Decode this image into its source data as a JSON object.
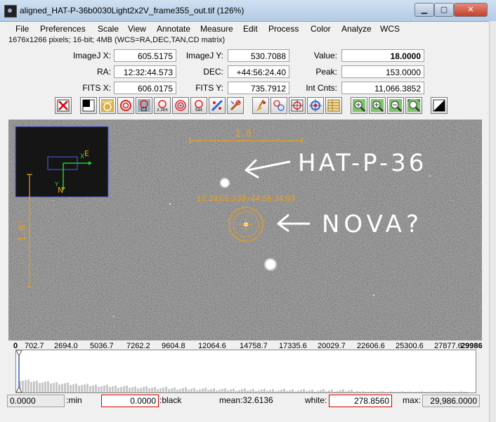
{
  "window": {
    "title": "aligned_HAT-P-36b0030Light2x2V_frame355_out.tif (126%)",
    "buttons": {
      "minimize": "▁",
      "maximize": "▢",
      "close": "✕"
    }
  },
  "menu": [
    "File",
    "Preferences",
    "Scale",
    "View",
    "Annotate",
    "Measure",
    "Edit",
    "Process",
    "Color",
    "Analyze",
    "WCS"
  ],
  "info_line": "1676x1266 pixels; 16-bit; 4MB (WCS=RA,DEC,TAN,CD matrix)",
  "readouts": {
    "imagej_x": {
      "label": "ImageJ X:",
      "value": "605.5175"
    },
    "imagej_y": {
      "label": "ImageJ Y:",
      "value": "530.7088"
    },
    "value": {
      "label": "Value:",
      "value": "18.0000"
    },
    "ra": {
      "label": "RA:",
      "value": "12:32:44.573"
    },
    "dec": {
      "label": "DEC:",
      "value": "+44:56:24.40"
    },
    "peak": {
      "label": "Peak:",
      "value": "153.0000"
    },
    "fits_x": {
      "label": "FITS X:",
      "value": "606.0175"
    },
    "fits_y": {
      "label": "FITS Y:",
      "value": "735.7912"
    },
    "int_cnts": {
      "label": "Int Cnts:",
      "value": "11,066.3852"
    }
  },
  "toolbar": {
    "icons": [
      "clear-overlay-icon",
      "invert-icon",
      "name-icon",
      "aperture-icon",
      "c2-icon",
      "2-2e6-icon",
      "annulus-icon",
      "set-aperture-icon",
      "astrometry-icon",
      "wand-icon",
      "broom-icon",
      "multi-aperture-icon",
      "radial-profile-icon",
      "target-icon",
      "table-icon",
      "zoom-in-fit-icon",
      "zoom-in-icon",
      "zoom-out-icon",
      "zoom-fit-icon",
      "contrast-icon"
    ],
    "labels": {
      "name": "NAME",
      "c2": "C2",
      "c2e6": "2.2E6",
      "set": "Set"
    }
  },
  "image": {
    "scale_bar_h": "1.8'",
    "scale_bar_v": "1.8'",
    "compass_e": "E",
    "compass_n": "N",
    "compass_x": "X",
    "compass_y": "Y",
    "coord_label": "12:33:05.333+44:55:34.93",
    "annotation_1": "HAT-P-36",
    "annotation_2": "NOVA?"
  },
  "histogram": {
    "tick_labels": [
      "0",
      "702.7",
      "2694.0",
      "5036.7",
      "7262.2",
      "9604.8",
      "12064.6",
      "14758.7",
      "17335.6",
      "20029.7",
      "22606.6",
      "25300.6",
      "27877.6",
      "29986"
    ]
  },
  "bottom": {
    "min_value": "0.0000",
    "min_label": ":min",
    "black_value": "0.0000",
    "black_label": ":black",
    "mean": "mean:32.6136",
    "white_label": "white:",
    "white_value": "278.8560",
    "max_label": "max:",
    "max_value": "29,986.0000"
  },
  "colors": {
    "annotation_orange": "#e8a020",
    "compass_green": "#22cc22",
    "overlay_blue": "#5060e0",
    "field_red_border": "#d00000"
  }
}
